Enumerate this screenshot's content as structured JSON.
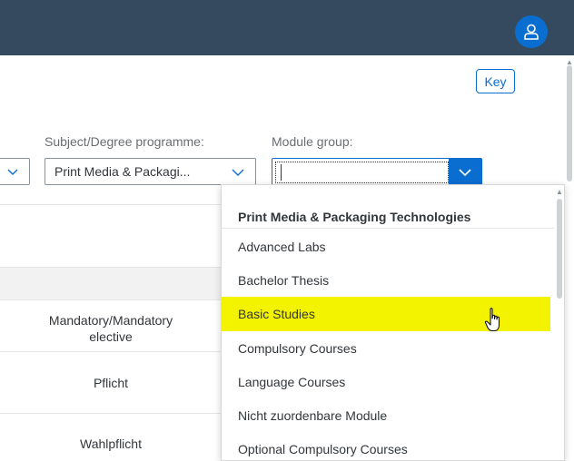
{
  "shell": {
    "user_icon": "person-icon"
  },
  "toolbar": {
    "key_label": "Key"
  },
  "filters": {
    "subject_label": "Subject/Degree programme:",
    "subject_value": "Print Media & Packagi...",
    "module_group_label": "Module group:",
    "module_group_value": ""
  },
  "table": {
    "header_mandatory_line1": "Mandatory/Mandatory",
    "header_mandatory_line2": "elective",
    "rows": [
      "Pflicht",
      "Wahlpflicht"
    ]
  },
  "dropdown": {
    "group_header": "Print Media & Packaging Technologies",
    "items": [
      "Advanced Labs",
      "Bachelor Thesis",
      "Basic Studies",
      "Compulsory Courses",
      "Language Courses",
      "Nicht zuordenbare Module",
      "Optional Compulsory Courses"
    ],
    "highlighted_index": 2,
    "highlight_color": "#f3f300"
  },
  "colors": {
    "shell": "#354a5f",
    "accent": "#0a6ed1"
  }
}
